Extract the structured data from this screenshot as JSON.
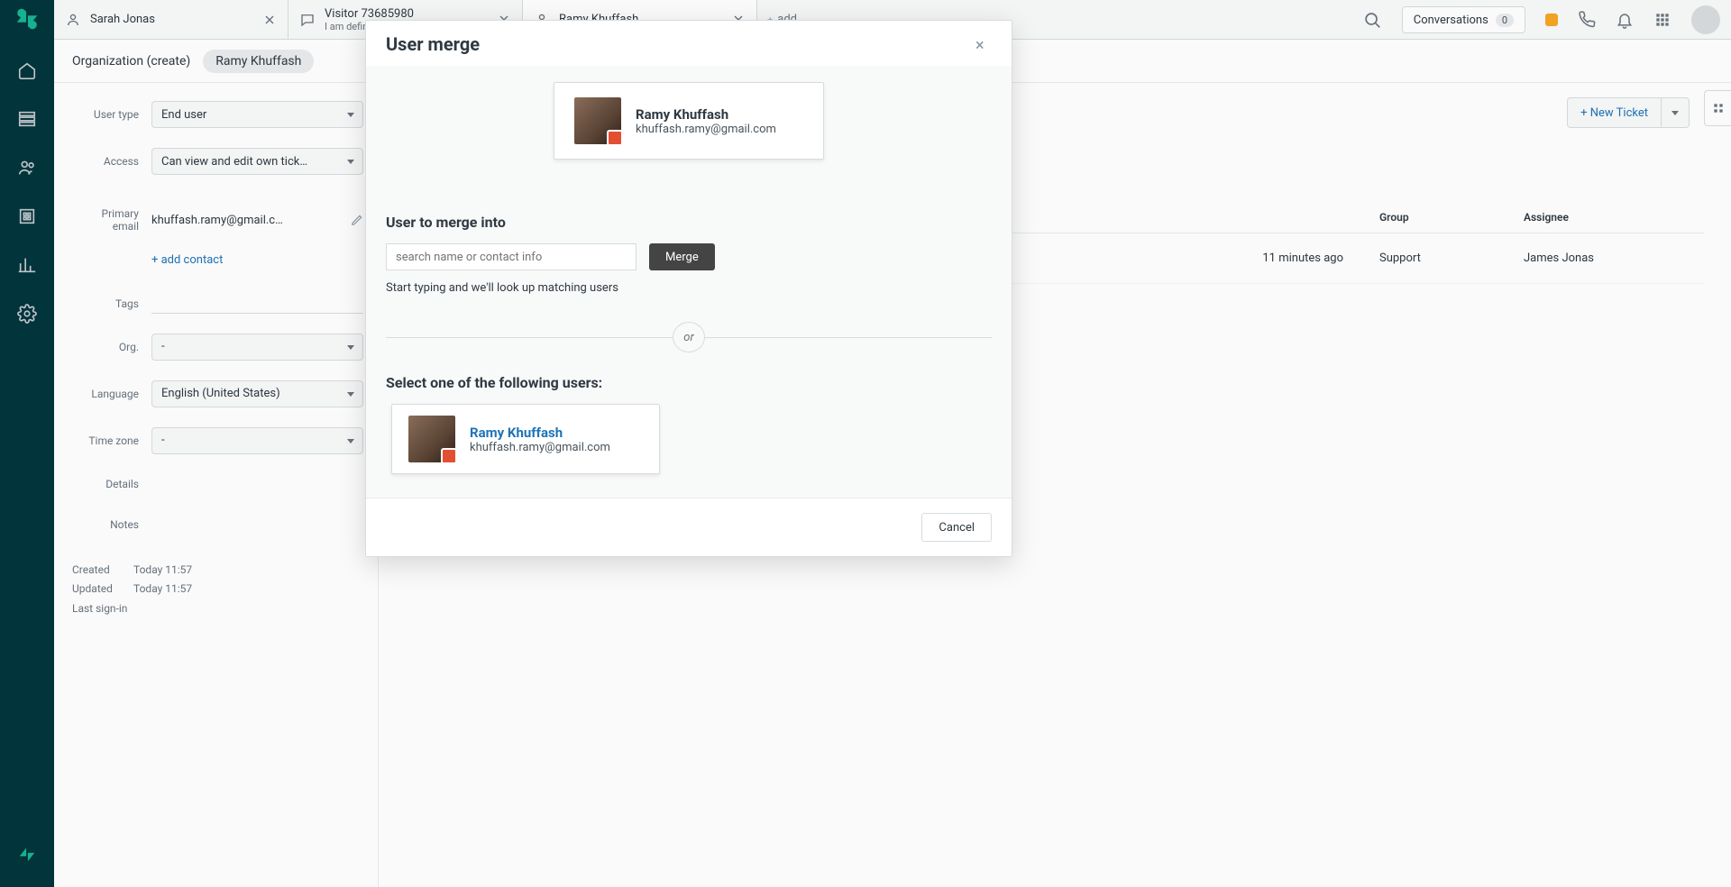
{
  "tabs": [
    {
      "title": "Sarah Jonas",
      "sub": ""
    },
    {
      "title": "Visitor 73685980",
      "sub": "I am definitely not a robot "
    },
    {
      "title": "Ramy Khuffash",
      "sub": ""
    }
  ],
  "tab_add_label": "add",
  "topbar": {
    "conversations_label": "Conversations",
    "conversations_count": "0"
  },
  "breadcrumb": {
    "org": "Organization (create)",
    "user": "Ramy Khuffash"
  },
  "detail": {
    "user_type_label": "User type",
    "user_type_value": "End user",
    "access_label": "Access",
    "access_value": "Can view and edit own tick…",
    "primary_email_label_line1": "Primary",
    "primary_email_label_line2": "email",
    "primary_email_value": "khuffash.ramy@gmail.c…",
    "add_contact": "+ add contact",
    "tags_label": "Tags",
    "tags_value": "-",
    "org_label": "Org.",
    "org_value": "-",
    "language_label": "Language",
    "language_value": "English (United States)",
    "timezone_label": "Time zone",
    "timezone_value": "-",
    "details_label": "Details",
    "notes_label": "Notes",
    "created_label": "Created",
    "created_value": "Today 11:57",
    "updated_label": "Updated",
    "updated_value": "Today 11:57",
    "signin_label": "Last sign-in"
  },
  "content": {
    "new_ticket": "+ New Ticket",
    "col_group": "Group",
    "col_assignee": "Assignee",
    "row": {
      "updated": "11 minutes ago",
      "group": "Support",
      "assignee": "James Jonas"
    }
  },
  "modal": {
    "title": "User merge",
    "primary_user_name": "Ramy Khuffash",
    "primary_user_email": "khuffash.ramy@gmail.com",
    "section_merge_into": "User to merge into",
    "search_placeholder": "search name or contact info",
    "merge_button": "Merge",
    "hint": "Start typing and we'll look up matching users",
    "or": "or",
    "section_select": "Select one of the following users:",
    "candidate_name": "Ramy Khuffash",
    "candidate_email": "khuffash.ramy@gmail.com",
    "cancel": "Cancel"
  }
}
